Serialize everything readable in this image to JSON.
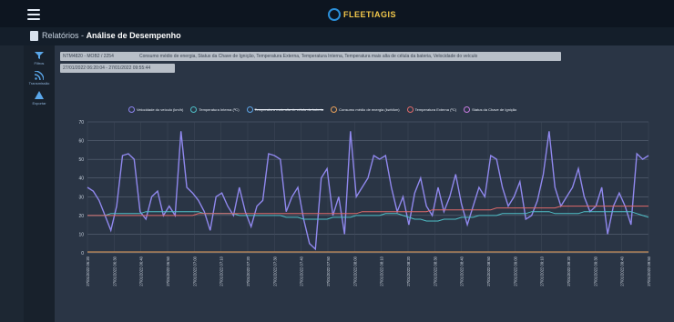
{
  "app": {
    "logo_text": "FLEETIAGIS"
  },
  "breadcrumb": {
    "section": "Relatórios",
    "separator": "-",
    "page": "Análise de Desempenho"
  },
  "sidebar": {
    "items": [
      {
        "icon": "filter-icon",
        "label": "Filtros"
      },
      {
        "icon": "rss-icon",
        "label": "Transmissão"
      },
      {
        "icon": "warning-icon",
        "label": "Exportar"
      }
    ]
  },
  "filters": {
    "vehicle": "NTM4820 - MOB2 / 2254",
    "metrics": "Consumo médio de energia, Status da Chave de Ignição, Temperatura Externa, Temperatura Interna, Temperatura mais alta de célula da bateria, Velocidade do veículo",
    "period": "27/01/2022 06:20:04 - 27/01/2022 09:55:44"
  },
  "legend": [
    {
      "label": "Velocidade do veículo (km/h)",
      "color": "#8d84f0",
      "struck": false
    },
    {
      "label": "Temperatura Interna (ºC)",
      "color": "#4fc0c8",
      "struck": false
    },
    {
      "label": "Temperatura mais alta de célula da bateria",
      "color": "#5da6e8",
      "struck": true
    },
    {
      "label": "Consumo médio de energia (kwh/km)",
      "color": "#e8a05a",
      "struck": false
    },
    {
      "label": "Temperatura Externa (ºC)",
      "color": "#e06a6a",
      "struck": false
    },
    {
      "label": "Status da Chave de Ignição",
      "color": "#c77be0",
      "struck": false
    }
  ],
  "chart_data": {
    "type": "line",
    "ylim": [
      0,
      70
    ],
    "yticks": [
      0,
      10,
      20,
      30,
      40,
      50,
      60,
      70
    ],
    "xticks": [
      "27/01/2022 06:20",
      "27/01/2022 06:30",
      "27/01/2022 06:40",
      "27/01/2022 06:50",
      "27/01/2022 07:00",
      "27/01/2022 07:10",
      "27/01/2022 07:20",
      "27/01/2022 07:30",
      "27/01/2022 07:40",
      "27/01/2022 07:50",
      "27/01/2022 08:00",
      "27/01/2022 08:10",
      "27/01/2022 08:20",
      "27/01/2022 08:30",
      "27/01/2022 08:40",
      "27/01/2022 08:50",
      "27/01/2022 09:00",
      "27/01/2022 09:10",
      "27/01/2022 09:20",
      "27/01/2022 09:30",
      "27/01/2022 09:40",
      "27/01/2022 09:50"
    ],
    "series": [
      {
        "name": "Velocidade do veículo (km/h)",
        "color": "#9088ee",
        "values": [
          35,
          33,
          28,
          20,
          12,
          25,
          52,
          53,
          50,
          22,
          18,
          30,
          33,
          20,
          25,
          20,
          65,
          35,
          32,
          28,
          22,
          12,
          30,
          32,
          25,
          20,
          35,
          22,
          14,
          25,
          28,
          53,
          52,
          50,
          22,
          30,
          35,
          18,
          5,
          2,
          40,
          45,
          20,
          30,
          10,
          65,
          30,
          35,
          40,
          52,
          50,
          52,
          35,
          22,
          30,
          15,
          32,
          40,
          25,
          20,
          35,
          22,
          30,
          42,
          26,
          15,
          25,
          35,
          30,
          52,
          50,
          35,
          25,
          30,
          38,
          18,
          20,
          28,
          42,
          65,
          35,
          25,
          30,
          35,
          45,
          30,
          22,
          25,
          35,
          10,
          25,
          32,
          25,
          15,
          53,
          50,
          52
        ]
      },
      {
        "name": "Temperatura Interna (ºC)",
        "color": "#4fc0c8",
        "values": [
          20,
          20,
          20,
          20,
          21,
          21,
          21,
          21,
          21,
          21,
          22,
          22,
          22,
          22,
          22,
          22,
          22,
          22,
          22,
          22,
          21,
          21,
          21,
          21,
          21,
          21,
          20,
          20,
          20,
          20,
          20,
          20,
          20,
          20,
          19,
          19,
          19,
          18,
          18,
          18,
          18,
          18,
          19,
          19,
          19,
          19,
          20,
          20,
          20,
          20,
          20,
          21,
          21,
          21,
          20,
          19,
          18,
          18,
          17,
          17,
          17,
          18,
          18,
          18,
          19,
          19,
          19,
          20,
          20,
          20,
          20,
          21,
          21,
          21,
          21,
          21,
          22,
          22,
          22,
          22,
          21,
          21,
          21,
          21,
          21,
          22,
          22,
          22,
          22,
          22,
          22,
          22,
          22,
          22,
          21,
          20,
          19
        ]
      },
      {
        "name": "Temperatura Externa (ºC)",
        "color": "#e06a6a",
        "values": [
          20,
          20,
          20,
          20,
          20,
          20,
          20,
          20,
          20,
          20,
          20,
          20,
          20,
          20,
          20,
          20,
          20,
          20,
          20,
          21,
          21,
          21,
          21,
          21,
          21,
          21,
          21,
          21,
          21,
          21,
          21,
          21,
          21,
          21,
          21,
          21,
          21,
          21,
          21,
          21,
          21,
          21,
          21,
          21,
          21,
          21,
          21,
          22,
          22,
          22,
          22,
          22,
          22,
          22,
          22,
          22,
          22,
          22,
          22,
          23,
          23,
          23,
          23,
          23,
          23,
          23,
          23,
          23,
          23,
          23,
          24,
          24,
          24,
          24,
          24,
          24,
          24,
          24,
          24,
          24,
          24,
          25,
          25,
          25,
          25,
          25,
          25,
          25,
          25,
          25,
          25,
          25,
          25,
          25,
          25,
          25,
          25
        ]
      },
      {
        "name": "Consumo médio de energia (kwh/km)",
        "color": "#e8a05a",
        "values": [
          0.5,
          0.5,
          0.5,
          0.5,
          0.5,
          0.5,
          0.5,
          0.5,
          0.5,
          0.5,
          0.5,
          0.5,
          0.5,
          0.5,
          0.5,
          0.5,
          0.5,
          0.5,
          0.5,
          0.5,
          0.5,
          0.5,
          0.5,
          0.5,
          0.5,
          0.5,
          0.5,
          0.5,
          0.5,
          0.5,
          0.5,
          0.5,
          0.5,
          0.5,
          0.5,
          0.5,
          0.5,
          0.5,
          0.5,
          0.5,
          0.5,
          0.5,
          0.5,
          0.5,
          0.5,
          0.5,
          0.5,
          0.5,
          0.5,
          0.5,
          0.5,
          0.5,
          0.5,
          0.5,
          0.5,
          0.5,
          0.5,
          0.5,
          0.5,
          0.5,
          0.5,
          0.5,
          0.5,
          0.5,
          0.5,
          0.5,
          0.5,
          0.5,
          0.5,
          0.5,
          0.5,
          0.5,
          0.5,
          0.5,
          0.5,
          0.5,
          0.5,
          0.5,
          0.5,
          0.5,
          0.5,
          0.5,
          0.5,
          0.5,
          0.5,
          0.5,
          0.5,
          0.5,
          0.5,
          0.5,
          0.5,
          0.5,
          0.5,
          0.5,
          0.5,
          0.5,
          0.5
        ]
      }
    ]
  }
}
